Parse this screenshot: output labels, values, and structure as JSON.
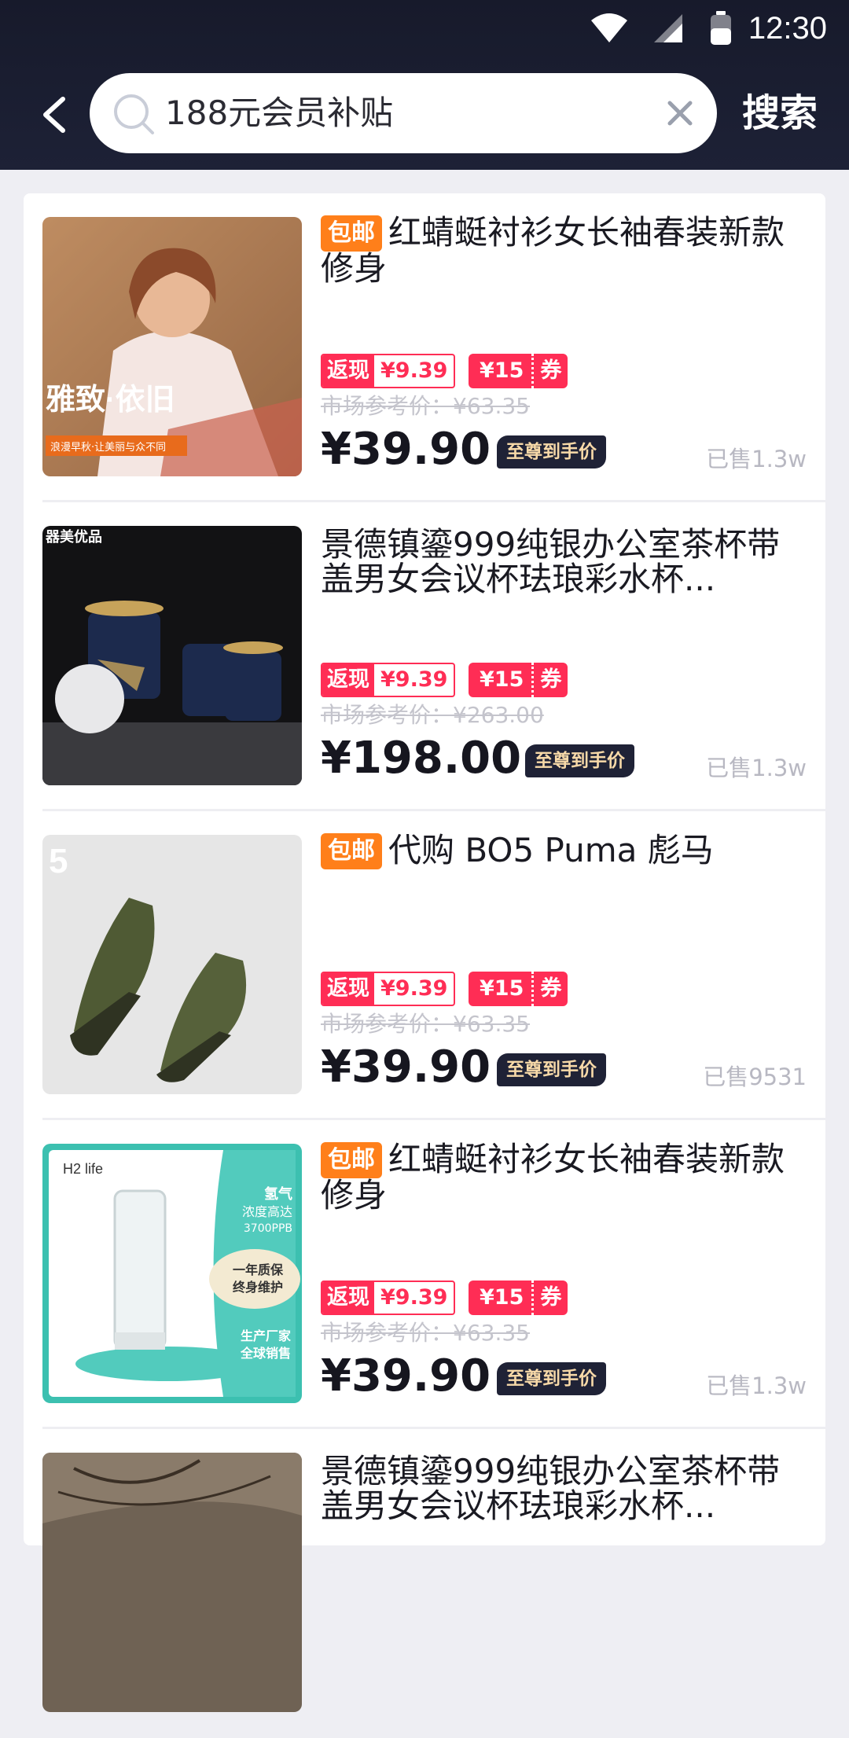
{
  "status_bar": {
    "time": "12:30"
  },
  "search": {
    "query": "188元会员补贴",
    "button_label": "搜索"
  },
  "colors": {
    "header_bg": "#1b1e31",
    "accent_red": "#ff2d55",
    "free_shipping_orange": "#ff7f1a",
    "vip_gold": "#f7d9a8"
  },
  "items": [
    {
      "free_shipping": "包邮",
      "title": "红蜻蜓衬衫女长袖春装新款修身",
      "cashback_label": "返现",
      "cashback_value": "¥9.39",
      "coupon_value": "¥15",
      "coupon_label": "券",
      "market_price": "市场参考价：¥63.35",
      "price": "¥39.90",
      "vip_label": "至尊到手价",
      "sold": "已售1.3w",
      "image_caption_main": "雅致·依旧",
      "image_caption_sub": "浪漫早秋·让美丽与众不同"
    },
    {
      "free_shipping": "",
      "title": "景德镇鎏999纯银办公室茶杯带盖男女会议杯珐琅彩水杯...",
      "cashback_label": "返现",
      "cashback_value": "¥9.39",
      "coupon_value": "¥15",
      "coupon_label": "券",
      "market_price": "市场参考价：¥263.00",
      "price": "¥198.00",
      "vip_label": "至尊到手价",
      "sold": "已售1.3w",
      "image_brand": "器美优品"
    },
    {
      "free_shipping": "包邮",
      "title": "代购 BO5 Puma 彪马",
      "cashback_label": "返现",
      "cashback_value": "¥9.39",
      "coupon_value": "¥15",
      "coupon_label": "券",
      "market_price": "市场参考价：¥63.35",
      "price": "¥39.90",
      "vip_label": "至尊到手价",
      "sold": "已售9531"
    },
    {
      "free_shipping": "包邮",
      "title": "红蜻蜓衬衫女长袖春装新款修身",
      "cashback_label": "返现",
      "cashback_value": "¥9.39",
      "coupon_value": "¥15",
      "coupon_label": "券",
      "market_price": "市场参考价：¥63.35",
      "price": "¥39.90",
      "vip_label": "至尊到手价",
      "sold": "已售1.3w",
      "image_brand": "H2 life",
      "image_text_1": "氢气",
      "image_text_2": "浓度高达",
      "image_text_3": "3700PPB",
      "image_text_4": "一年质保",
      "image_text_5": "终身维护",
      "image_text_6": "生产厂家",
      "image_text_7": "全球销售"
    },
    {
      "free_shipping": "",
      "title": "景德镇鎏999纯银办公室茶杯带盖男女会议杯珐琅彩水杯..."
    }
  ]
}
